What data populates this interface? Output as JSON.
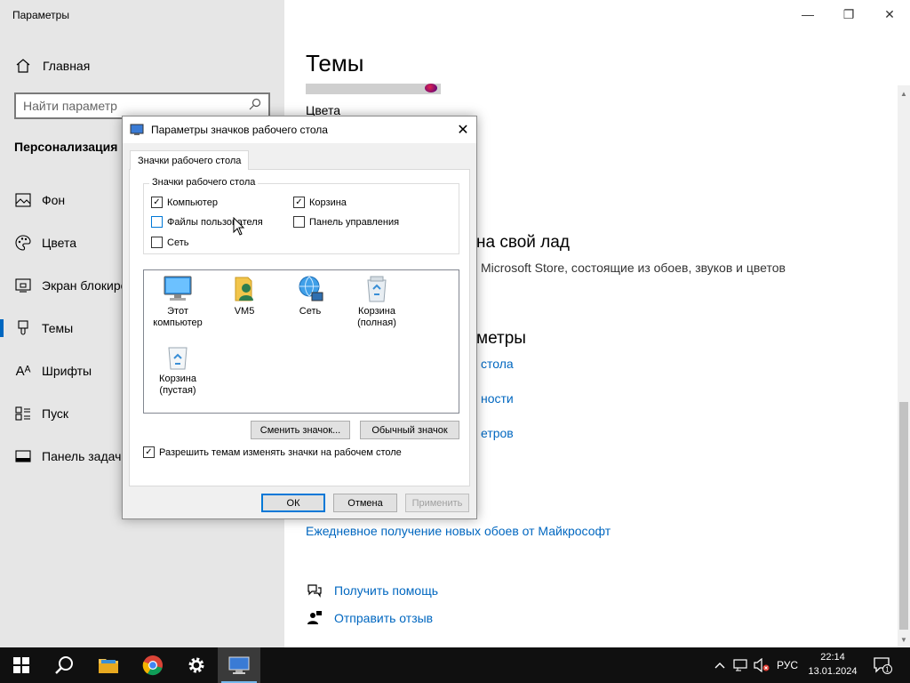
{
  "app": {
    "title": "Параметры",
    "window_controls": {
      "minimize": "—",
      "maximize": "❐",
      "close": "✕"
    }
  },
  "sidebar": {
    "home_label": "Главная",
    "search_placeholder": "Найти параметр",
    "section_title": "Персонализация",
    "items": [
      {
        "label": "Фон",
        "icon": "image-icon"
      },
      {
        "label": "Цвета",
        "icon": "palette-icon"
      },
      {
        "label": "Экран блокировки",
        "icon": "lock-screen-icon"
      },
      {
        "label": "Темы",
        "icon": "brush-icon",
        "active": true
      },
      {
        "label": "Шрифты",
        "icon": "font-icon"
      },
      {
        "label": "Пуск",
        "icon": "start-icon"
      },
      {
        "label": "Панель задач",
        "icon": "taskbar-icon"
      }
    ]
  },
  "main": {
    "title": "Темы",
    "colors_label": "Цвета",
    "heading_fragment_1": "на свой лад",
    "store_text": "Microsoft Store, состоящие из обоев, звуков и цветов",
    "heading_fragment_2": "метры",
    "link_fragment_1": "стола",
    "link_fragment_2": "ности",
    "link_fragment_3": "етров",
    "daily_wallpaper_link": "Ежедневное получение новых обоев от Майкрософт",
    "help_link": "Получить помощь",
    "feedback_link": "Отправить отзыв"
  },
  "dialog": {
    "title": "Параметры значков рабочего стола",
    "close": "✕",
    "tab": "Значки рабочего стола",
    "group_legend": "Значки рабочего стола",
    "checkboxes": {
      "computer": {
        "label": "Компьютер",
        "checked": true
      },
      "recycle_bin": {
        "label": "Корзина",
        "checked": true
      },
      "user_files": {
        "label": "Файлы пользователя",
        "checked": false
      },
      "control_panel": {
        "label": "Панель управления",
        "checked": false
      },
      "network": {
        "label": "Сеть",
        "checked": false
      }
    },
    "icons": {
      "this_pc": "Этот компьютер",
      "user": "VM5",
      "network": "Сеть",
      "bin_full": "Корзина (полная)",
      "bin_empty": "Корзина (пустая)"
    },
    "change_icon_button": "Сменить значок...",
    "default_icon_button": "Обычный значок",
    "allow_themes": {
      "label": "Разрешить темам изменять значки на рабочем столе",
      "checked": true
    },
    "ok_button": "ОК",
    "cancel_button": "Отмена",
    "apply_button": "Применить"
  },
  "taskbar": {
    "language": "РУС",
    "time": "22:14",
    "date": "13.01.2024",
    "notification_count": "1"
  },
  "colors": {
    "accent": "#0067c0",
    "sidebar_bg": "#e6e6e6",
    "taskbar_bg": "#101010"
  }
}
